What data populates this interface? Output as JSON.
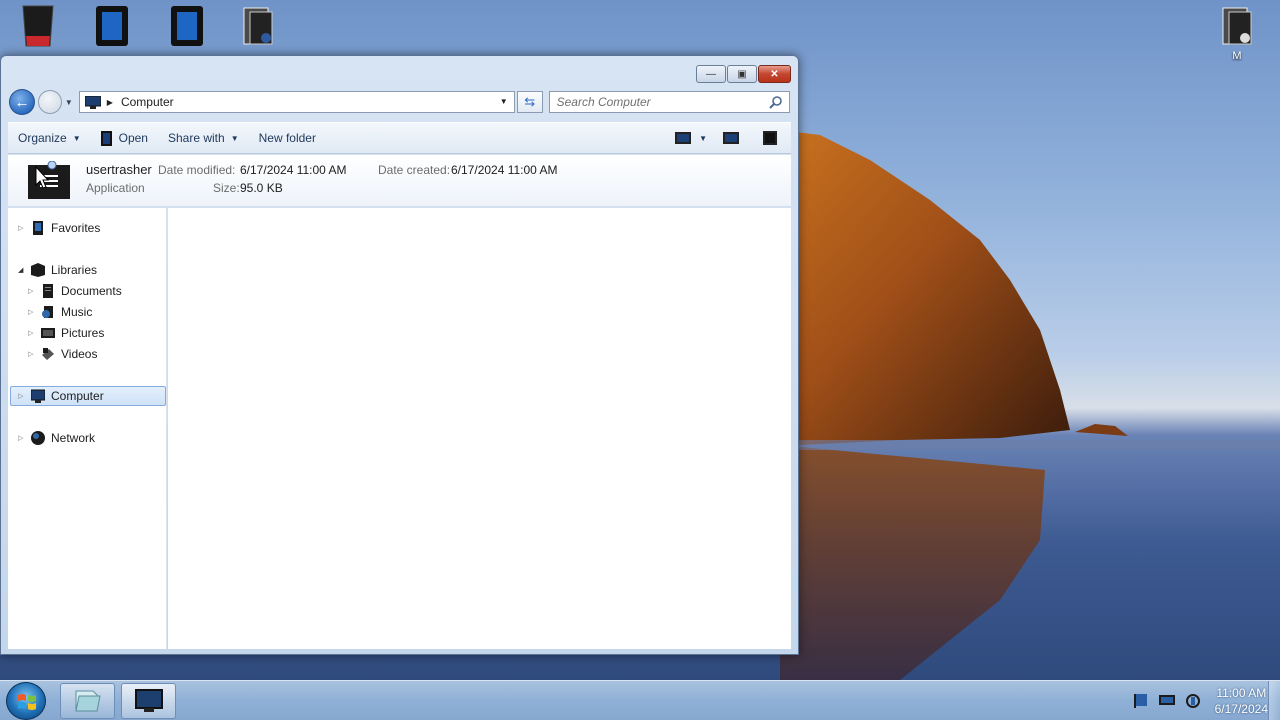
{
  "desktop": {
    "icons": [
      {
        "name": "recycle-bin-icon",
        "caption": ""
      },
      {
        "name": "tablet-icon",
        "caption": ""
      },
      {
        "name": "tablet-icon-2",
        "caption": ""
      },
      {
        "name": "document-folder-icon",
        "caption": ""
      },
      {
        "name": "document-folder-icon-right",
        "caption": "M"
      }
    ]
  },
  "window": {
    "address": {
      "location": "Computer"
    },
    "search": {
      "placeholder": "Search Computer"
    },
    "toolbar": {
      "organize": "Organize",
      "open": "Open",
      "share_with": "Share with",
      "new_folder": "New folder"
    },
    "details": {
      "name": "usertrasher",
      "type": "Application",
      "date_modified_label": "Date modified:",
      "date_modified_value": "6/17/2024 11:00 AM",
      "date_created_label": "Date created:",
      "date_created_value": "6/17/2024 11:00 AM",
      "size_label": "Size:",
      "size_value": "95.0 KB"
    },
    "nav": {
      "favorites": "Favorites",
      "libraries": "Libraries",
      "documents": "Documents",
      "music": "Music",
      "pictures": "Pictures",
      "videos": "Videos",
      "computer": "Computer",
      "network": "Network"
    }
  },
  "taskbar": {
    "clock_time": "11:00 AM",
    "clock_date": "6/17/2024"
  },
  "colors": {
    "accent": "#2c6bc0",
    "close_button": "#c44630",
    "selection": "#cfe2f8"
  }
}
